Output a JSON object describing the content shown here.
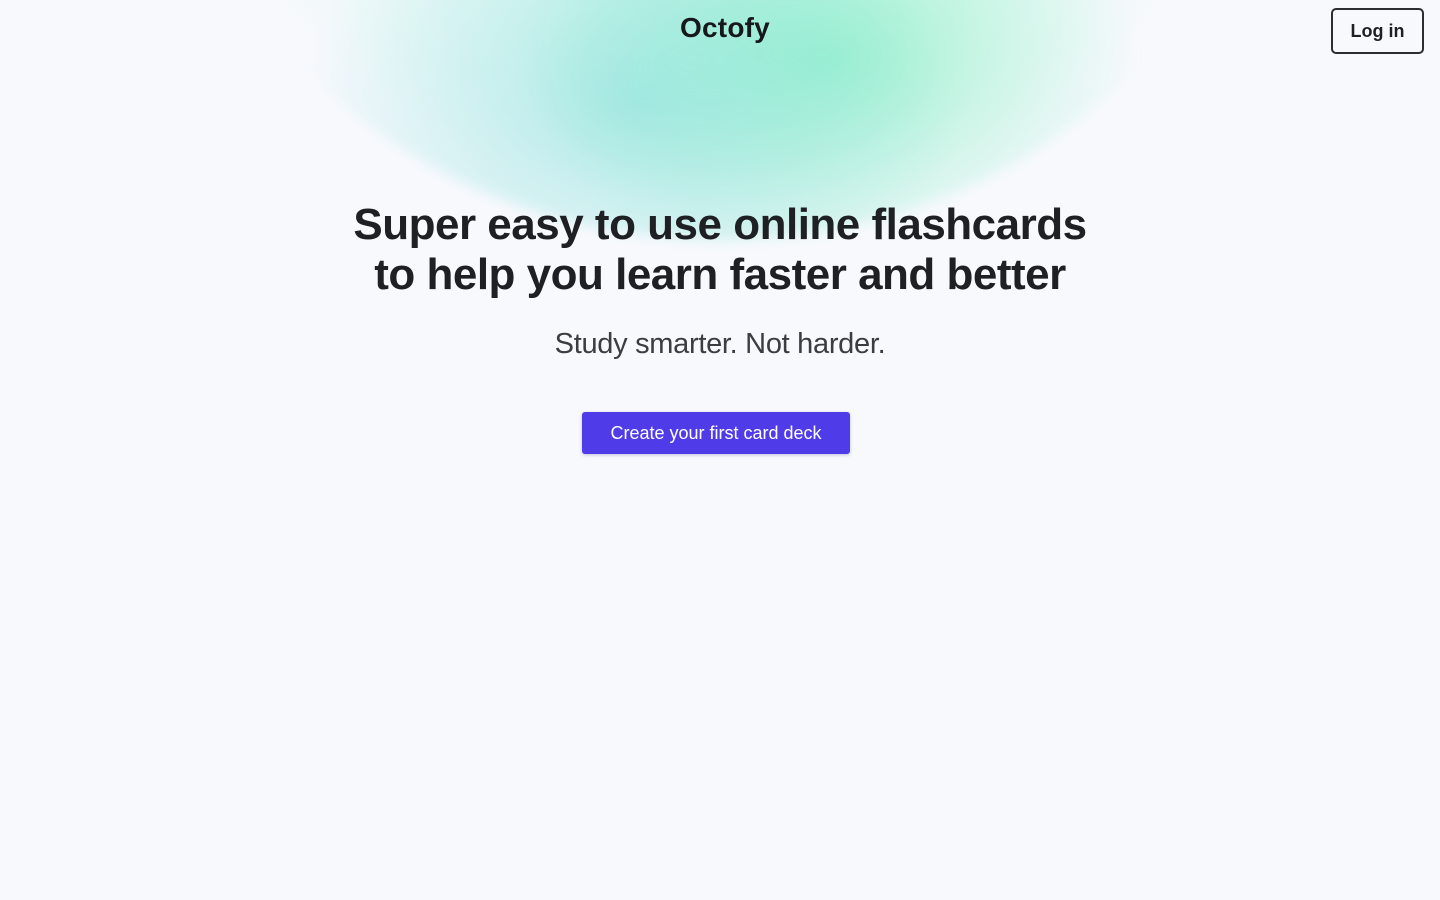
{
  "header": {
    "brand": "Octofy",
    "login_label": "Log in"
  },
  "hero": {
    "headline": "Super easy to use online flashcards to help you learn faster and better",
    "subtitle": "Study smarter. Not harder.",
    "cta_label": "Create your first card deck"
  },
  "colors": {
    "background": "#f7f9fd",
    "accent": "#4f3be8",
    "glow": "#7de8c0",
    "text": "#1e2024"
  }
}
